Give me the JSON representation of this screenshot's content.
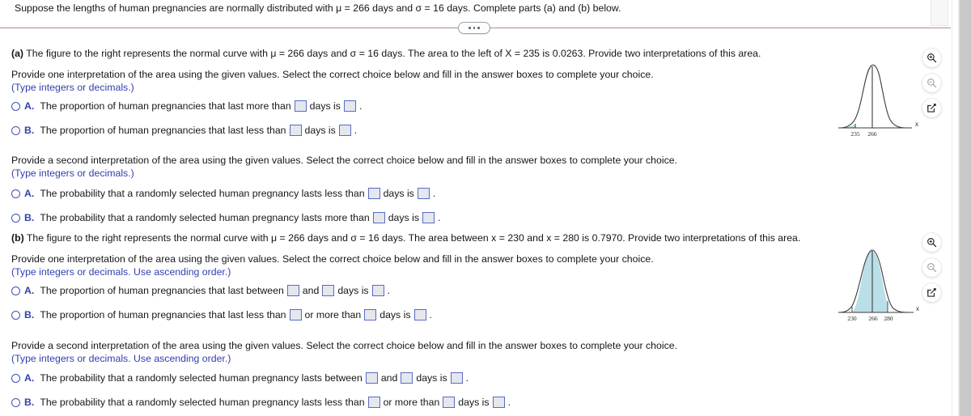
{
  "prompt": "Suppose the lengths of human pregnancies are normally distributed with μ = 266 days and σ = 16 days. Complete parts (a) and (b) below.",
  "divider": {
    "more_button_label": "…",
    "icon": "ellipsis-icon"
  },
  "part_a": {
    "label": "(a)",
    "statement": " The figure to the right represents the normal curve with μ = 266 days and σ = 16 days. The area to the left of X = 235 is 0.0263. Provide two interpretations of this area.",
    "first_instruction": "Provide one interpretation of the area using the given values. Select the correct choice below and fill in the answer boxes to complete your choice.",
    "first_hint": "(Type integers or decimals.)",
    "first_choices": [
      {
        "key": "A.",
        "pre": "The proportion of human pregnancies that last more than",
        "mid": "days is",
        "post": "."
      },
      {
        "key": "B.",
        "pre": "The proportion of human pregnancies that last less than",
        "mid": "days is",
        "post": "."
      }
    ],
    "second_instruction": "Provide a second interpretation of the area using the given values. Select the correct choice below and fill in the answer boxes to complete your choice.",
    "second_hint": "(Type integers or decimals.)",
    "second_choices": [
      {
        "key": "A.",
        "pre": "The probability that a randomly selected human pregnancy lasts less than",
        "mid": "days is",
        "post": "."
      },
      {
        "key": "B.",
        "pre": "The probability that a randomly selected human pregnancy lasts more than",
        "mid": "days is",
        "post": "."
      }
    ]
  },
  "part_b": {
    "label": "(b)",
    "statement": " The figure to the right represents the normal curve with μ = 266 days and σ = 16 days. The area between x = 230 and x = 280 is 0.7970. Provide two interpretations of this area.",
    "first_instruction": "Provide one interpretation of the area using the given values. Select the correct choice below and fill in the answer boxes to complete your choice.",
    "first_hint": "(Type integers or decimals. Use ascending order.)",
    "first_choices": [
      {
        "key": "A.",
        "pre": "The proportion of human pregnancies that last between",
        "mid1": "and",
        "mid2": "days is",
        "post": "."
      },
      {
        "key": "B.",
        "pre": "The proportion of human pregnancies that last less than",
        "mid1": "or more than",
        "mid2": "days is",
        "post": "."
      }
    ],
    "second_instruction": "Provide a second interpretation of the area using the given values. Select the correct choice below and fill in the answer boxes to complete your choice.",
    "second_hint": "(Type integers or decimals. Use ascending order.)",
    "second_choices": [
      {
        "key": "A.",
        "pre": "The probability that a randomly selected human pregnancy lasts between",
        "mid1": "and",
        "mid2": "days is",
        "post": "."
      },
      {
        "key": "B.",
        "pre": "The probability that a randomly selected human pregnancy lasts less than",
        "mid1": "or more than",
        "mid2": "days is",
        "post": "."
      }
    ]
  },
  "figure_a": {
    "axis_label": "x",
    "tick_left": "235",
    "tick_center": "266",
    "shade_color": "#b9dfe8",
    "curve_color": "#3a3a3a"
  },
  "figure_b": {
    "axis_label": "x",
    "tick_left": "230",
    "tick_center": "266",
    "tick_right": "280",
    "shade_color": "#b9dfe8",
    "curve_color": "#3a3a3a"
  },
  "chart_data": [
    {
      "type": "area",
      "title": "",
      "xlabel": "x",
      "ylabel": "",
      "distribution": "normal",
      "mu": 266,
      "sigma": 16,
      "ticks": [
        235,
        266
      ],
      "shaded_region": {
        "from": null,
        "to": 235,
        "area": 0.0263,
        "label": "area to the left of X = 235"
      },
      "grid": false,
      "legend": "none"
    },
    {
      "type": "area",
      "title": "",
      "xlabel": "x",
      "ylabel": "",
      "distribution": "normal",
      "mu": 266,
      "sigma": 16,
      "ticks": [
        230,
        266,
        280
      ],
      "shaded_region": {
        "from": 230,
        "to": 280,
        "area": 0.797,
        "label": "area between x = 230 and x = 280"
      },
      "grid": false,
      "legend": "none"
    }
  ],
  "tools": {
    "zoom_in": "zoom-in-icon",
    "zoom_out": "zoom-out-icon",
    "pop_out": "pop-out-icon"
  }
}
